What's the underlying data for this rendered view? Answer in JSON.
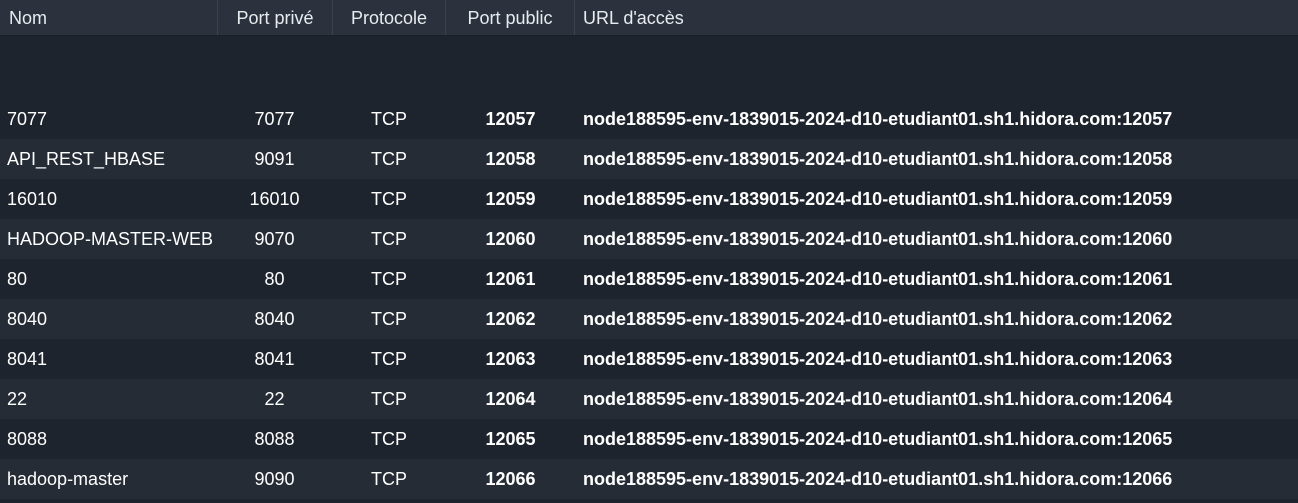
{
  "columns": {
    "name": "Nom",
    "private_port": "Port privé",
    "protocol": "Protocole",
    "public_port": "Port public",
    "url": "URL d'accès"
  },
  "rows": [
    {
      "name": "7077",
      "private_port": "7077",
      "protocol": "TCP",
      "public_port": "12057",
      "url": "node188595-env-1839015-2024-d10-etudiant01.sh1.hidora.com:12057"
    },
    {
      "name": "API_REST_HBASE",
      "private_port": "9091",
      "protocol": "TCP",
      "public_port": "12058",
      "url": "node188595-env-1839015-2024-d10-etudiant01.sh1.hidora.com:12058"
    },
    {
      "name": "16010",
      "private_port": "16010",
      "protocol": "TCP",
      "public_port": "12059",
      "url": "node188595-env-1839015-2024-d10-etudiant01.sh1.hidora.com:12059"
    },
    {
      "name": "HADOOP-MASTER-WEB",
      "private_port": "9070",
      "protocol": "TCP",
      "public_port": "12060",
      "url": "node188595-env-1839015-2024-d10-etudiant01.sh1.hidora.com:12060"
    },
    {
      "name": "80",
      "private_port": "80",
      "protocol": "TCP",
      "public_port": "12061",
      "url": "node188595-env-1839015-2024-d10-etudiant01.sh1.hidora.com:12061"
    },
    {
      "name": "8040",
      "private_port": "8040",
      "protocol": "TCP",
      "public_port": "12062",
      "url": "node188595-env-1839015-2024-d10-etudiant01.sh1.hidora.com:12062"
    },
    {
      "name": "8041",
      "private_port": "8041",
      "protocol": "TCP",
      "public_port": "12063",
      "url": "node188595-env-1839015-2024-d10-etudiant01.sh1.hidora.com:12063"
    },
    {
      "name": "22",
      "private_port": "22",
      "protocol": "TCP",
      "public_port": "12064",
      "url": "node188595-env-1839015-2024-d10-etudiant01.sh1.hidora.com:12064"
    },
    {
      "name": "8088",
      "private_port": "8088",
      "protocol": "TCP",
      "public_port": "12065",
      "url": "node188595-env-1839015-2024-d10-etudiant01.sh1.hidora.com:12065"
    },
    {
      "name": "hadoop-master",
      "private_port": "9090",
      "protocol": "TCP",
      "public_port": "12066",
      "url": "node188595-env-1839015-2024-d10-etudiant01.sh1.hidora.com:12066"
    }
  ]
}
